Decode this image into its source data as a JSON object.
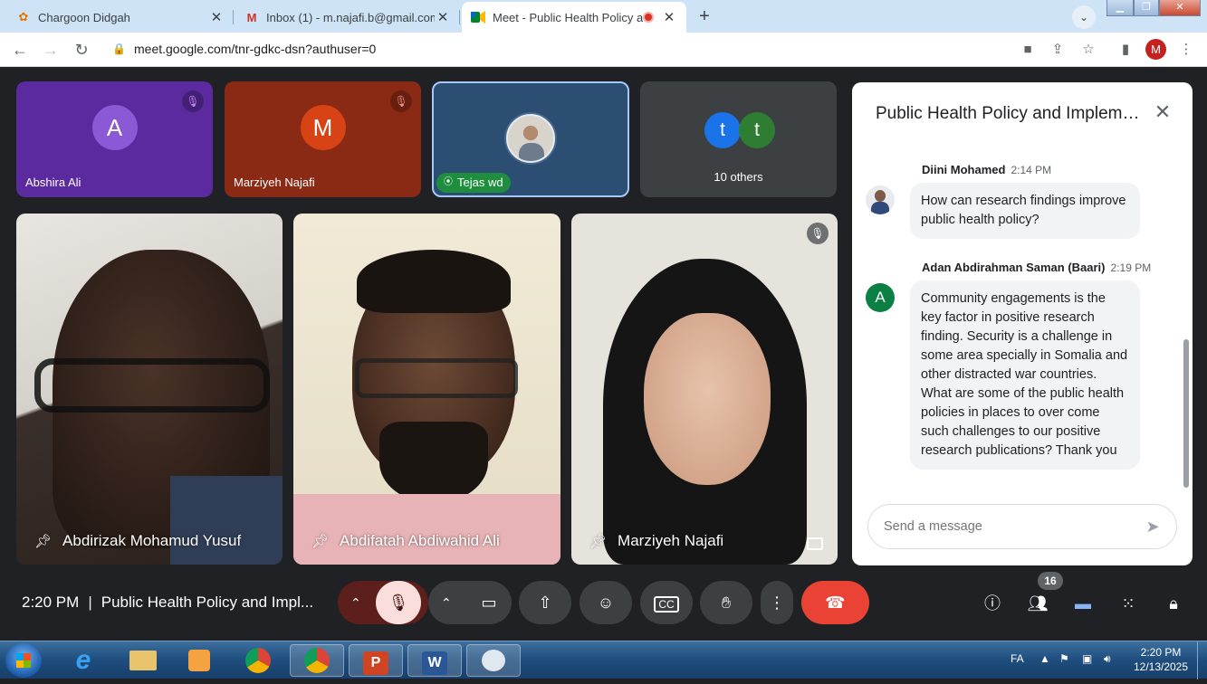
{
  "browser": {
    "tabs": [
      {
        "title": "Chargoon Didgah",
        "favicon": "chargoon-icon",
        "active": false
      },
      {
        "title": "Inbox (1) - m.najafi.b@gmail.com",
        "favicon": "gmail-icon",
        "active": false
      },
      {
        "title": "Meet - Public Health Policy a",
        "favicon": "meet-icon",
        "active": true
      }
    ],
    "url": "meet.google.com/tnr-gdkc-dsn?authuser=0",
    "profile_initial": "M"
  },
  "participants_small": [
    {
      "name": "Abshira Ali",
      "initial": "A",
      "muted": true,
      "bg": "#5b2a9e",
      "avatar_color": "#8b58d6"
    },
    {
      "name": "Marziyeh Najafi",
      "initial": "M",
      "muted": true,
      "bg": "#8a2a14",
      "avatar_color": "#d84315"
    },
    {
      "name": "Tejas wd",
      "speaking": true,
      "bg": "#2d4e73"
    },
    {
      "others_label": "10 others",
      "initials": [
        "t",
        "t"
      ],
      "colors": [
        "#1a73e8",
        "#2e7d32"
      ]
    }
  ],
  "participants_video": [
    {
      "name": "Abdirizak Mohamud Yusuf"
    },
    {
      "name": "Abdifatah Abdiwahid Ali"
    },
    {
      "name": "Marziyeh Najafi",
      "muted": true
    }
  ],
  "chat": {
    "title": "Public Health Policy and Implementation",
    "messages": [
      {
        "sender": "Diini Mohamed",
        "time": "2:14 PM",
        "text": "How can research findings improve public health policy?"
      },
      {
        "sender": "Adan Abdirahman Saman (Baari)",
        "time": "2:19 PM",
        "avatar_initial": "A",
        "avatar_color": "#0b8043",
        "text": "Community engagements is the key factor in positive research finding. Security is a challenge in some area specially in Somalia and other distracted war countries. What are some of the public health policies in places to over come such challenges to our positive research publications? Thank you"
      }
    ],
    "input_placeholder": "Send a message"
  },
  "meeting": {
    "time": "2:20 PM",
    "separator": "|",
    "title": "Public Health Policy and Impl...",
    "participant_count": "16"
  },
  "taskbar": {
    "language": "FA",
    "clock_time": "2:20 PM",
    "clock_date": "12/13/2025"
  }
}
